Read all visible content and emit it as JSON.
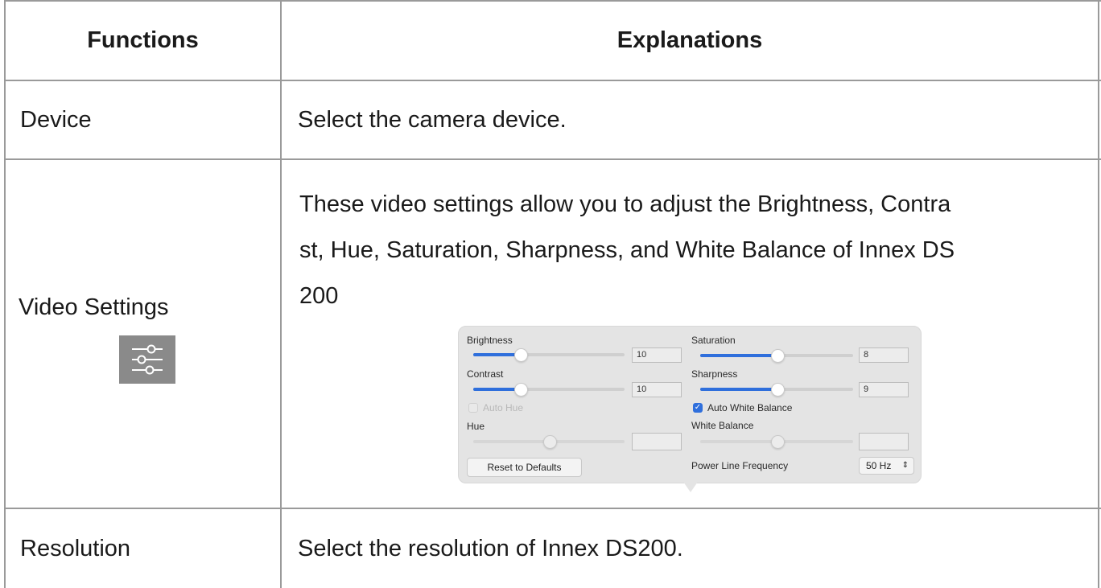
{
  "table": {
    "headers": {
      "functions": "Functions",
      "explanations": "Explanations"
    },
    "rows": [
      {
        "function": "Device",
        "explanation": "Select the camera device."
      },
      {
        "function": "Video Settings",
        "explanation_lines": [
          "These video settings allow you to adjust the Brightness, Contra",
          "st, Hue, Saturation, Sharpness, and White Balance of Innex DS",
          "200"
        ],
        "icon": "sliders-icon"
      },
      {
        "function": "Resolution",
        "explanation": "Select the resolution of Innex DS200."
      }
    ]
  },
  "panel": {
    "brightness": {
      "label": "Brightness",
      "value": "10",
      "level": 0.31
    },
    "contrast": {
      "label": "Contrast",
      "value": "10",
      "level": 0.31
    },
    "auto_hue": {
      "label": "Auto Hue",
      "checked": false
    },
    "hue": {
      "label": "Hue",
      "value": "",
      "level": 0.5
    },
    "reset_button": "Reset to Defaults",
    "saturation": {
      "label": "Saturation",
      "value": "8",
      "level": 0.5
    },
    "sharpness": {
      "label": "Sharpness",
      "value": "9",
      "level": 0.5
    },
    "auto_white_balance": {
      "label": "Auto White Balance",
      "checked": true
    },
    "white_balance": {
      "label": "White Balance",
      "value": "",
      "level": 0.5
    },
    "power_line_frequency": {
      "label": "Power Line Frequency",
      "selected": "50 Hz"
    }
  },
  "colors": {
    "accent": "#2f6fdc",
    "grid": "#9a9a9a",
    "panel_bg": "#e4e4e4",
    "icon_bg": "#8a8a8a"
  }
}
